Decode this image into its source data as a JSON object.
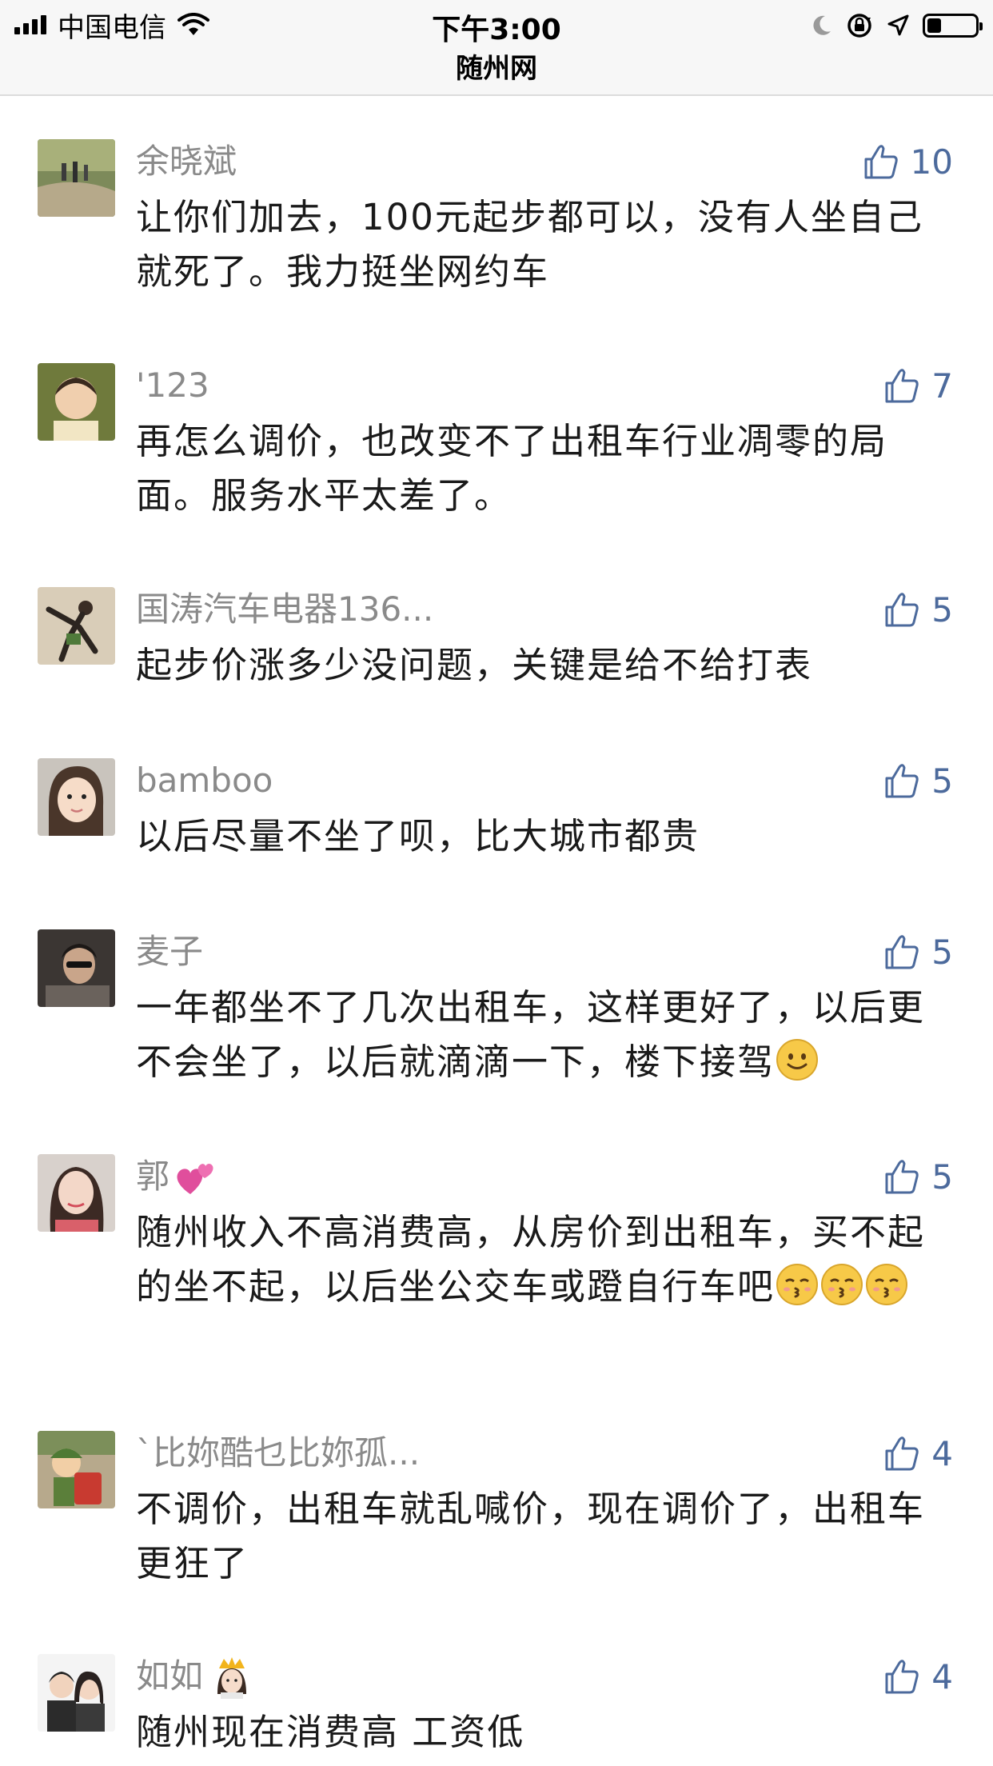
{
  "status_bar": {
    "carrier": "中国电信",
    "time": "下午3:00",
    "battery_level": 0.3
  },
  "nav": {
    "title": "随州网"
  },
  "comments": [
    {
      "name": "余晓斌",
      "likes": "10",
      "text": "让你们加去，100元起步都可以，没有人坐自己就死了。我力挺坐网约车",
      "avatar_icon": "landscape-photo-avatar"
    },
    {
      "name": "'123",
      "likes": "7",
      "text": "再怎么调价，也改变不了出租车行业凋零的局面。服务水平太差了。",
      "avatar_icon": "child-photo-avatar"
    },
    {
      "name": "国涛汽车电器136...",
      "likes": "5",
      "text": "起步价涨多少没问题，关键是给不给打表",
      "avatar_icon": "person-photo-avatar"
    },
    {
      "name": "bamboo",
      "likes": "5",
      "text": "以后尽量不坐了呗，比大城市都贵",
      "avatar_icon": "girl-photo-avatar"
    },
    {
      "name": "麦子",
      "likes": "5",
      "text": "一年都坐不了几次出租车，这样更好了，以后更不会坐了，以后就滴滴一下，楼下接驾",
      "avatar_icon": "man-photo-avatar",
      "trailing_emoji": [
        "smile-emoji"
      ]
    },
    {
      "name": "郭",
      "name_emoji": "heart-emoji",
      "likes": "5",
      "text": "随州收入不高消费高，从房价到出租车，买不起的坐不起，以后坐公交车或蹬自行车吧",
      "avatar_icon": "woman-photo-avatar",
      "trailing_emoji": [
        "kiss-emoji",
        "kiss-emoji",
        "kiss-emoji"
      ]
    },
    {
      "name": "`比妳酷乜比妳孤...",
      "likes": "4",
      "text": "不调价，出租车就乱喊价，现在调价了，出租车更狂了",
      "avatar_icon": "cartoon-photo-avatar"
    },
    {
      "name": "如如",
      "name_emoji": "princess-emoji",
      "likes": "4",
      "text": "随州现在消费高 工资低",
      "avatar_icon": "couple-photo-avatar"
    }
  ],
  "colors": {
    "like_blue": "#4c6a9c",
    "name_gray": "#8a8a8a",
    "text_dark": "#1a1a1a"
  }
}
